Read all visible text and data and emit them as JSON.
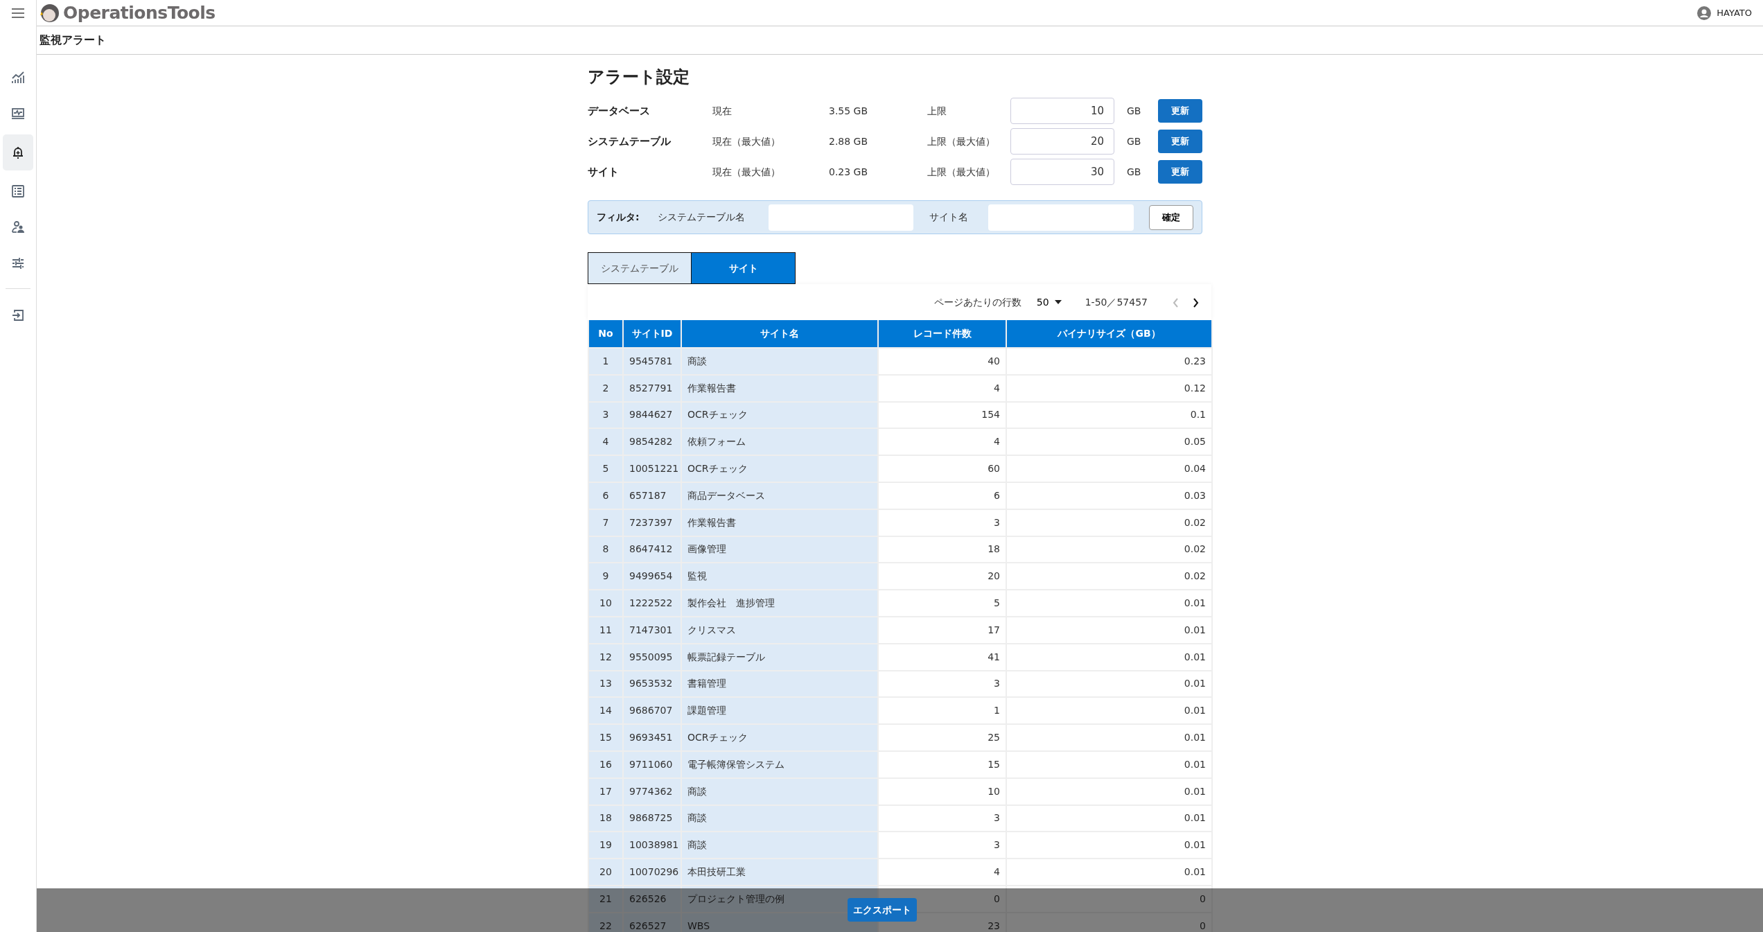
{
  "header": {
    "logo": "OperationsTools",
    "user": "HAYATO"
  },
  "sidebar": {
    "items": [
      {
        "selected": false
      },
      {
        "selected": false
      },
      {
        "selected": true
      },
      {
        "selected": false
      },
      {
        "selected": false
      },
      {
        "selected": false
      }
    ],
    "bottom_items": [
      {
        "selected": false
      }
    ]
  },
  "breadcrumb": "監視アラート",
  "settings": {
    "title": "アラート設定",
    "rows": [
      {
        "label": "データベース",
        "current_label": "現在",
        "current": "3.55 GB",
        "limit_label": "上限",
        "limit": "10",
        "unit": "GB",
        "button": "更新"
      },
      {
        "label": "システムテーブル",
        "current_label": "現在（最大値）",
        "current": "2.88 GB",
        "limit_label": "上限（最大値）",
        "limit": "20",
        "unit": "GB",
        "button": "更新"
      },
      {
        "label": "サイト",
        "current_label": "現在（最大値）",
        "current": "0.23 GB",
        "limit_label": "上限（最大値）",
        "limit": "30",
        "unit": "GB",
        "button": "更新"
      }
    ]
  },
  "filter": {
    "label": "フィルタ:",
    "fields": [
      {
        "label": "システムテーブル名"
      },
      {
        "label": "サイト名"
      }
    ],
    "button": "確定"
  },
  "tabs": [
    {
      "label": "システムテーブル",
      "selected": false
    },
    {
      "label": "サイト",
      "selected": true
    }
  ],
  "pagination": {
    "rows_per_page_label": "ページあたりの行数",
    "rows_per_page": "50",
    "range": "1-50／57457",
    "buttons": [
      {
        "kind": "prev",
        "disabled": true
      },
      {
        "kind": "next",
        "disabled": false
      }
    ]
  },
  "table": {
    "columns": [
      "No",
      "サイトID",
      "サイト名",
      "レコード件数",
      "バイナリサイズ（GB）"
    ],
    "rows": [
      [
        "1",
        "9545781",
        "商談",
        "40",
        "0.23"
      ],
      [
        "2",
        "8527791",
        "作業報告書",
        "4",
        "0.12"
      ],
      [
        "3",
        "9844627",
        "OCRチェック",
        "154",
        "0.1"
      ],
      [
        "4",
        "9854282",
        "依頼フォーム",
        "4",
        "0.05"
      ],
      [
        "5",
        "10051221",
        "OCRチェック",
        "60",
        "0.04"
      ],
      [
        "6",
        "657187",
        "商品データベース",
        "6",
        "0.03"
      ],
      [
        "7",
        "7237397",
        "作業報告書",
        "3",
        "0.02"
      ],
      [
        "8",
        "8647412",
        "画像管理",
        "18",
        "0.02"
      ],
      [
        "9",
        "9499654",
        "監視",
        "20",
        "0.02"
      ],
      [
        "10",
        "1222522",
        "製作会社　進捗管理",
        "5",
        "0.01"
      ],
      [
        "11",
        "7147301",
        "クリスマス",
        "17",
        "0.01"
      ],
      [
        "12",
        "9550095",
        "帳票記録テーブル",
        "41",
        "0.01"
      ],
      [
        "13",
        "9653532",
        "書籍管理",
        "3",
        "0.01"
      ],
      [
        "14",
        "9686707",
        "課題管理",
        "1",
        "0.01"
      ],
      [
        "15",
        "9693451",
        "OCRチェック",
        "25",
        "0.01"
      ],
      [
        "16",
        "9711060",
        "電子帳簿保管システム",
        "15",
        "0.01"
      ],
      [
        "17",
        "9774362",
        "商談",
        "10",
        "0.01"
      ],
      [
        "18",
        "9868725",
        "商談",
        "3",
        "0.01"
      ],
      [
        "19",
        "10038981",
        "商談",
        "3",
        "0.01"
      ],
      [
        "20",
        "10070296",
        "本田技研工業",
        "4",
        "0.01"
      ],
      [
        "21",
        "626526",
        "プロジェクト管理の例",
        "0",
        "0"
      ],
      [
        "22",
        "626527",
        "WBS",
        "23",
        "0"
      ]
    ]
  },
  "export_button": "エクスポート"
}
